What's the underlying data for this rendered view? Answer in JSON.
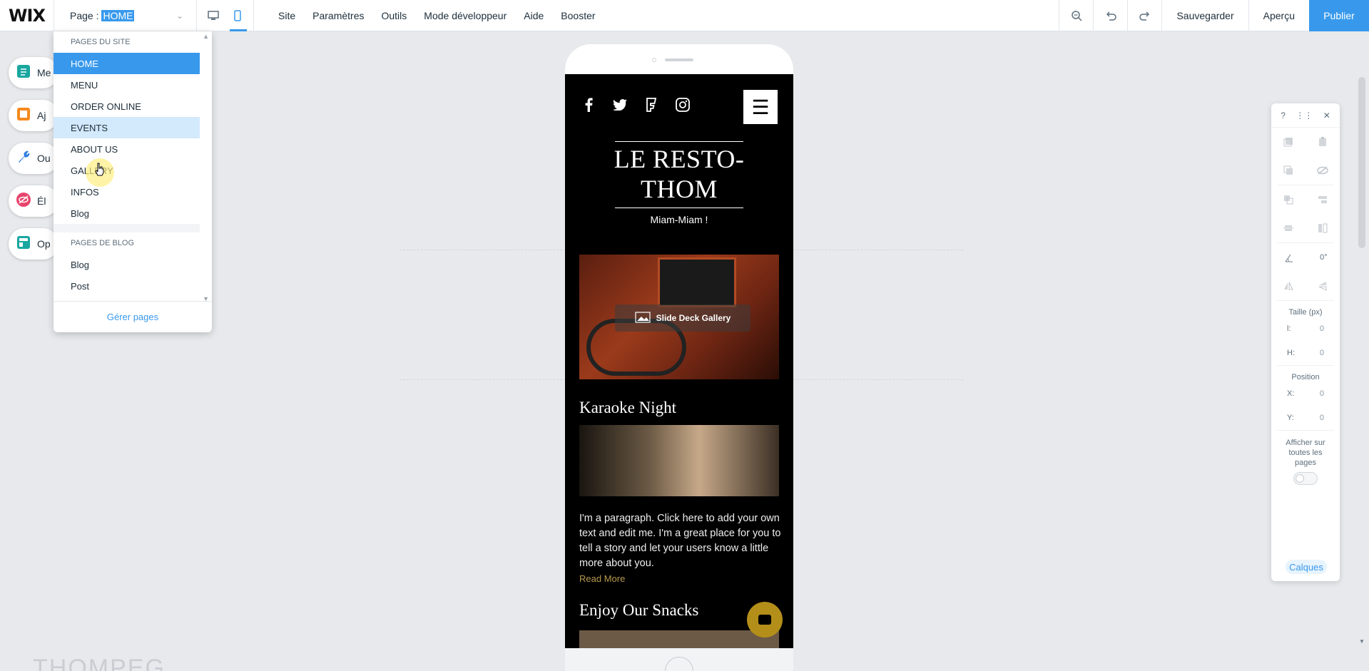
{
  "topbar": {
    "logo": "WIX",
    "page_label": "Page :",
    "page_value": "HOME",
    "menu": [
      "Site",
      "Paramètres",
      "Outils",
      "Mode développeur",
      "Aide",
      "Booster"
    ],
    "save_label": "Sauvegarder",
    "preview_label": "Aperçu",
    "publish_label": "Publier"
  },
  "rail": [
    "Me",
    "Aj",
    "Ou",
    "Él",
    "Op"
  ],
  "dropdown": {
    "site_pages_title": "PAGES DU SITE",
    "site_pages": [
      "HOME",
      "MENU",
      "ORDER ONLINE",
      "EVENTS",
      "ABOUT US",
      "GALLERY",
      "INFOS",
      "Blog"
    ],
    "blog_pages_title": "PAGES DE BLOG",
    "blog_pages": [
      "Blog",
      "Post"
    ],
    "manage_label": "Gérer pages"
  },
  "phone": {
    "brand": "LE RESTO-THOM",
    "tagline": "Miam-Miam !",
    "gallery_label": "Slide Deck Gallery",
    "section1_title": "Karaoke Night",
    "paragraph": "I'm a paragraph. Click here to add your own text and edit me. I'm a great place for you to tell a story and let your users know a little more about you.",
    "read_more": "Read More",
    "section2_title": "Enjoy Our Snacks"
  },
  "right_toolbar": {
    "help": "?",
    "rotation": "0°",
    "size_title": "Taille (px)",
    "width_label": "l:",
    "width_value": "0",
    "height_label": "H:",
    "height_value": "0",
    "position_title": "Position",
    "x_label": "X:",
    "x_value": "0",
    "y_label": "Y:",
    "y_value": "0",
    "show_all_pages": "Afficher sur toutes les pages",
    "layers_label": "Calques"
  },
  "watermark": "THOMPEG"
}
